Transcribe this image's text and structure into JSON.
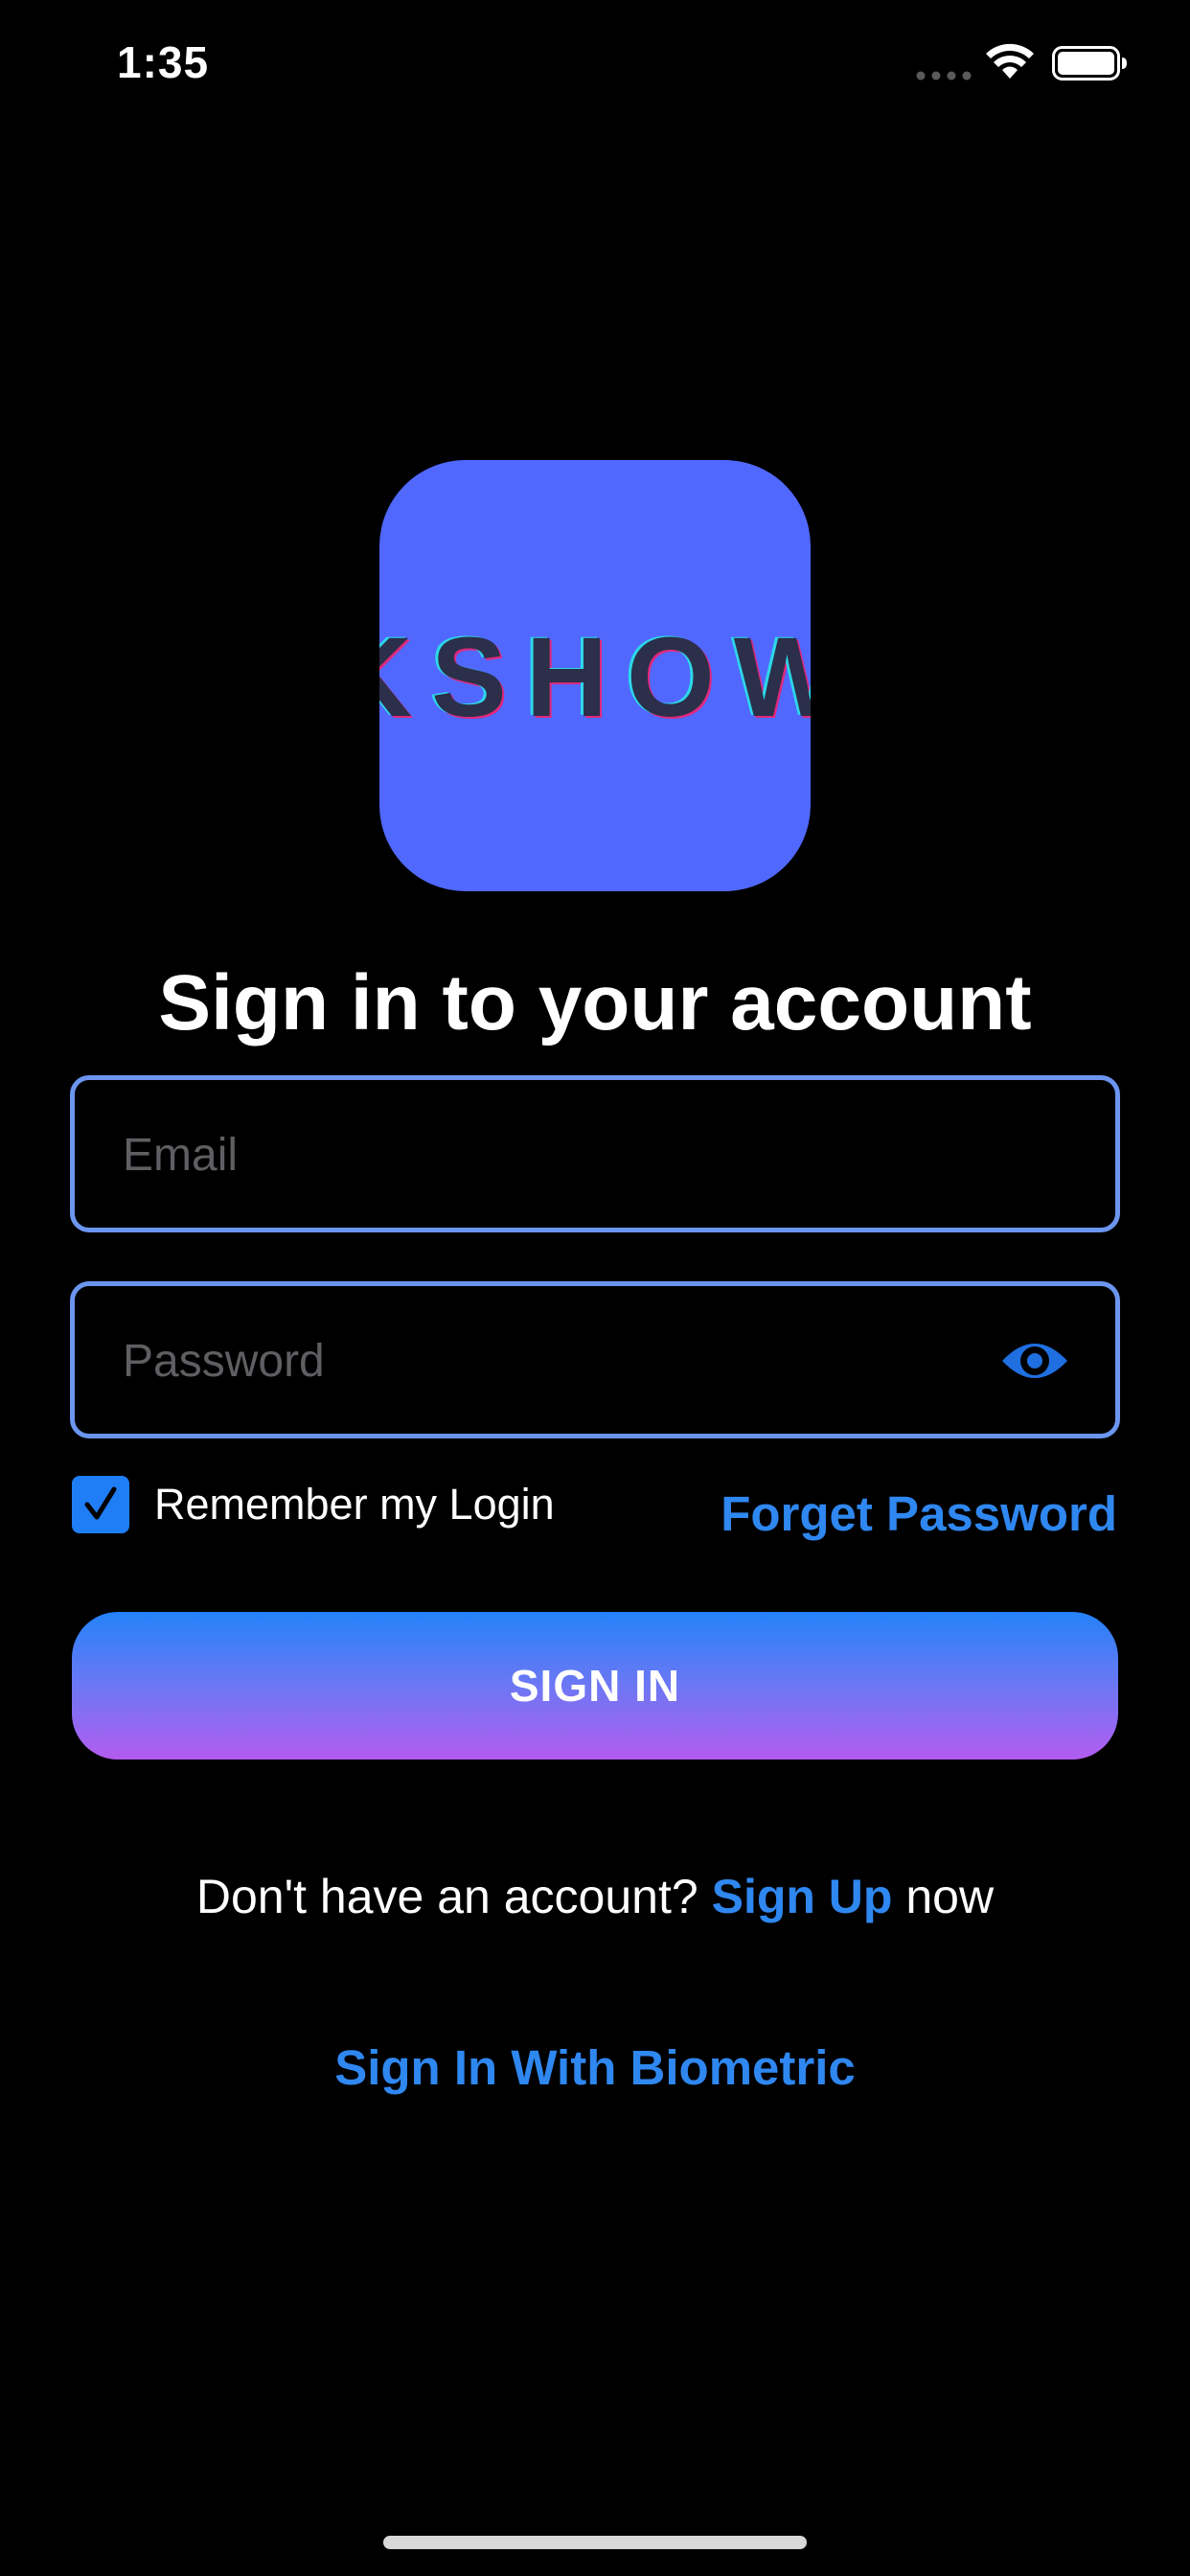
{
  "status_bar": {
    "time": "1:35",
    "signal_icon": "cellular-signal-icon",
    "wifi_icon": "wifi-icon",
    "battery_icon": "battery-icon"
  },
  "logo": {
    "text": "KSHOW",
    "background": "#5168fe"
  },
  "title": "Sign in to your account",
  "email": {
    "placeholder": "Email",
    "value": ""
  },
  "password": {
    "placeholder": "Password",
    "value": "",
    "toggle_icon": "eye-icon"
  },
  "remember": {
    "label": "Remember my Login",
    "checked": true
  },
  "forget_password": "Forget Password",
  "sign_in_button": "SIGN IN",
  "signup": {
    "prefix": "Don't have an account?",
    "link": "Sign Up",
    "suffix": "now"
  },
  "biometric": "Sign In With Biometric",
  "colors": {
    "accent": "#2f87f0",
    "field_border": "#6b95ef",
    "button_gradient_top": "#2482f8",
    "button_gradient_bottom": "#b25cef"
  }
}
